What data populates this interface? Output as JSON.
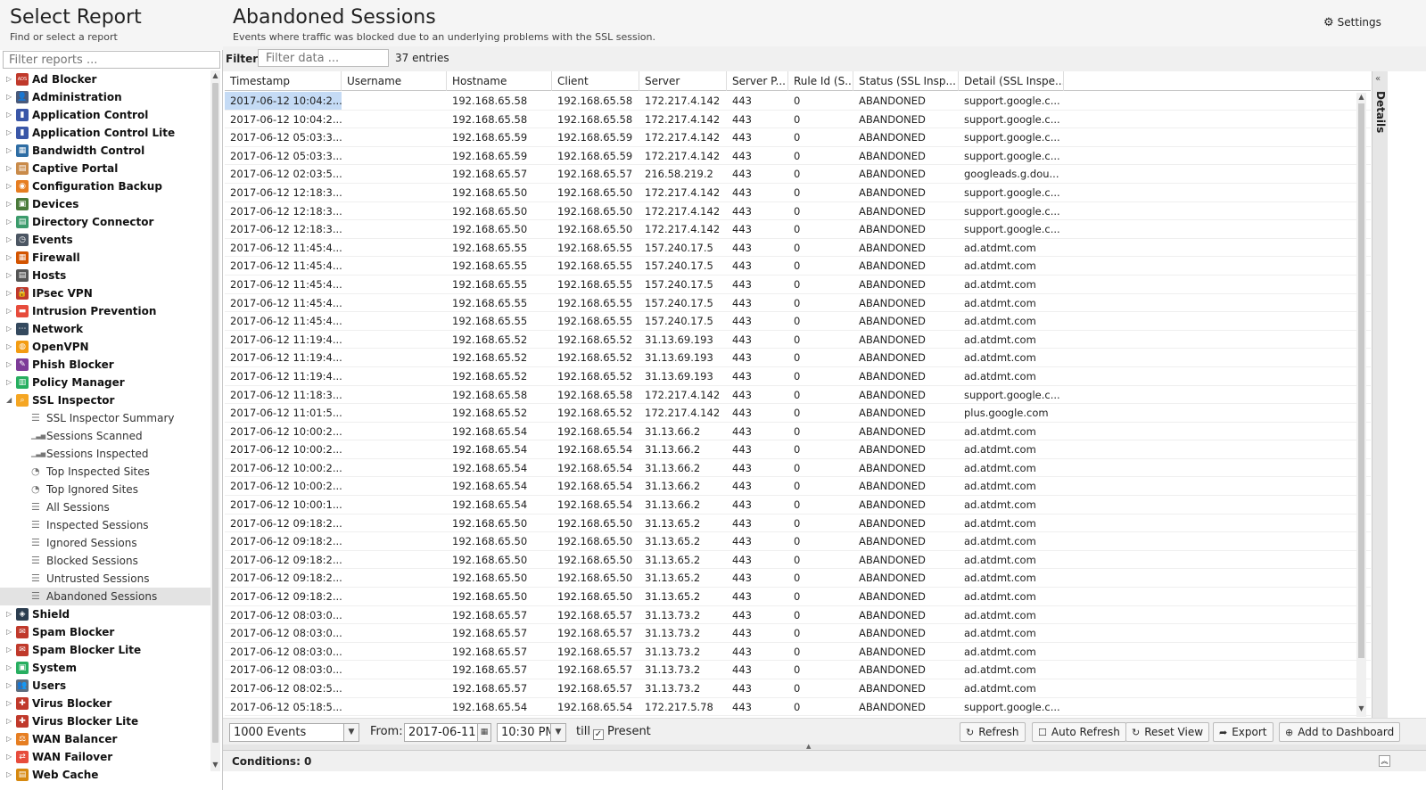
{
  "left": {
    "title": "Select Report",
    "subtitle": "Find or select a report",
    "filter_placeholder": "Filter reports ..."
  },
  "tree": [
    {
      "label": "Ad Blocker",
      "icon": "ad-blocker-icon",
      "color": "#c0392b",
      "glyph": "ADS"
    },
    {
      "label": "Administration",
      "icon": "administration-icon",
      "color": "#4a5a7a",
      "glyph": "👤"
    },
    {
      "label": "Application Control",
      "icon": "application-control-icon",
      "color": "#3a57a8",
      "glyph": "▮"
    },
    {
      "label": "Application Control Lite",
      "icon": "application-control-lite-icon",
      "color": "#3a57a8",
      "glyph": "▮"
    },
    {
      "label": "Bandwidth Control",
      "icon": "bandwidth-control-icon",
      "color": "#2e6da4",
      "glyph": "▦"
    },
    {
      "label": "Captive Portal",
      "icon": "captive-portal-icon",
      "color": "#c98b4a",
      "glyph": "▤"
    },
    {
      "label": "Configuration Backup",
      "icon": "configuration-backup-icon",
      "color": "#e67e22",
      "glyph": "◉"
    },
    {
      "label": "Devices",
      "icon": "devices-icon",
      "color": "#4a7a3a",
      "glyph": "▣"
    },
    {
      "label": "Directory Connector",
      "icon": "directory-connector-icon",
      "color": "#3c9b6c",
      "glyph": "▤"
    },
    {
      "label": "Events",
      "icon": "events-icon",
      "color": "#4c5663",
      "glyph": "◷"
    },
    {
      "label": "Firewall",
      "icon": "firewall-icon",
      "color": "#d35400",
      "glyph": "▦"
    },
    {
      "label": "Hosts",
      "icon": "hosts-icon",
      "color": "#555555",
      "glyph": "▤"
    },
    {
      "label": "IPsec VPN",
      "icon": "ipsec-vpn-icon",
      "color": "#c0392b",
      "glyph": "🔒"
    },
    {
      "label": "Intrusion Prevention",
      "icon": "intrusion-prevention-icon",
      "color": "#e74c3c",
      "glyph": "▬"
    },
    {
      "label": "Network",
      "icon": "network-icon",
      "color": "#34495e",
      "glyph": "⋯"
    },
    {
      "label": "OpenVPN",
      "icon": "openvpn-icon",
      "color": "#f39c12",
      "glyph": "◍"
    },
    {
      "label": "Phish Blocker",
      "icon": "phish-blocker-icon",
      "color": "#7d3c98",
      "glyph": "✎"
    },
    {
      "label": "Policy Manager",
      "icon": "policy-manager-icon",
      "color": "#27ae60",
      "glyph": "▥"
    },
    {
      "label": "SSL Inspector",
      "icon": "ssl-inspector-icon",
      "color": "#f5a623",
      "glyph": "⌕",
      "expanded": true,
      "children": [
        {
          "label": "SSL Inspector Summary",
          "icon": "list-icon",
          "glyph": "☰"
        },
        {
          "label": "Sessions Scanned",
          "icon": "bar-chart-icon",
          "glyph": "▁▃▅"
        },
        {
          "label": "Sessions Inspected",
          "icon": "bar-chart-icon",
          "glyph": "▁▃▅"
        },
        {
          "label": "Top Inspected Sites",
          "icon": "pie-chart-icon",
          "glyph": "◔"
        },
        {
          "label": "Top Ignored Sites",
          "icon": "pie-chart-icon",
          "glyph": "◔"
        },
        {
          "label": "All Sessions",
          "icon": "list-icon",
          "glyph": "☰"
        },
        {
          "label": "Inspected Sessions",
          "icon": "list-icon",
          "glyph": "☰"
        },
        {
          "label": "Ignored Sessions",
          "icon": "list-icon",
          "glyph": "☰"
        },
        {
          "label": "Blocked Sessions",
          "icon": "list-icon",
          "glyph": "☰"
        },
        {
          "label": "Untrusted Sessions",
          "icon": "list-icon",
          "glyph": "☰"
        },
        {
          "label": "Abandoned Sessions",
          "icon": "list-icon",
          "glyph": "☰",
          "selected": true
        }
      ]
    },
    {
      "label": "Shield",
      "icon": "shield-icon",
      "color": "#2c3e50",
      "glyph": "◈"
    },
    {
      "label": "Spam Blocker",
      "icon": "spam-blocker-icon",
      "color": "#c0392b",
      "glyph": "✉"
    },
    {
      "label": "Spam Blocker Lite",
      "icon": "spam-blocker-lite-icon",
      "color": "#c0392b",
      "glyph": "✉"
    },
    {
      "label": "System",
      "icon": "system-icon",
      "color": "#27ae60",
      "glyph": "▣"
    },
    {
      "label": "Users",
      "icon": "users-icon",
      "color": "#5d6d7e",
      "glyph": "👥"
    },
    {
      "label": "Virus Blocker",
      "icon": "virus-blocker-icon",
      "color": "#c0392b",
      "glyph": "✚"
    },
    {
      "label": "Virus Blocker Lite",
      "icon": "virus-blocker-lite-icon",
      "color": "#c0392b",
      "glyph": "✚"
    },
    {
      "label": "WAN Balancer",
      "icon": "wan-balancer-icon",
      "color": "#e67e22",
      "glyph": "⚖"
    },
    {
      "label": "WAN Failover",
      "icon": "wan-failover-icon",
      "color": "#e74c3c",
      "glyph": "⇄"
    },
    {
      "label": "Web Cache",
      "icon": "web-cache-icon",
      "color": "#d68910",
      "glyph": "▤"
    }
  ],
  "main": {
    "title": "Abandoned Sessions",
    "subtitle": "Events where traffic was blocked due to an underlying problems with the SSL session.",
    "settings_label": "Settings",
    "filter_label": "Filter:",
    "filter_placeholder": "Filter data ...",
    "entries_count": "37 entries"
  },
  "grid": {
    "columns": [
      "Timestamp",
      "Username",
      "Hostname",
      "Client",
      "Server",
      "Server P...",
      "Rule Id (S...",
      "Status (SSL Insp...",
      "Detail (SSL Inspe..."
    ],
    "rows": [
      [
        "2017-06-12 10:04:2...",
        "",
        "192.168.65.58",
        "192.168.65.58",
        "172.217.4.142",
        "443",
        "0",
        "ABANDONED",
        "support.google.c..."
      ],
      [
        "2017-06-12 10:04:2...",
        "",
        "192.168.65.58",
        "192.168.65.58",
        "172.217.4.142",
        "443",
        "0",
        "ABANDONED",
        "support.google.c..."
      ],
      [
        "2017-06-12 05:03:3...",
        "",
        "192.168.65.59",
        "192.168.65.59",
        "172.217.4.142",
        "443",
        "0",
        "ABANDONED",
        "support.google.c..."
      ],
      [
        "2017-06-12 05:03:3...",
        "",
        "192.168.65.59",
        "192.168.65.59",
        "172.217.4.142",
        "443",
        "0",
        "ABANDONED",
        "support.google.c..."
      ],
      [
        "2017-06-12 02:03:5...",
        "",
        "192.168.65.57",
        "192.168.65.57",
        "216.58.219.2",
        "443",
        "0",
        "ABANDONED",
        "googleads.g.dou..."
      ],
      [
        "2017-06-12 12:18:3...",
        "",
        "192.168.65.50",
        "192.168.65.50",
        "172.217.4.142",
        "443",
        "0",
        "ABANDONED",
        "support.google.c..."
      ],
      [
        "2017-06-12 12:18:3...",
        "",
        "192.168.65.50",
        "192.168.65.50",
        "172.217.4.142",
        "443",
        "0",
        "ABANDONED",
        "support.google.c..."
      ],
      [
        "2017-06-12 12:18:3...",
        "",
        "192.168.65.50",
        "192.168.65.50",
        "172.217.4.142",
        "443",
        "0",
        "ABANDONED",
        "support.google.c..."
      ],
      [
        "2017-06-12 11:45:4...",
        "",
        "192.168.65.55",
        "192.168.65.55",
        "157.240.17.5",
        "443",
        "0",
        "ABANDONED",
        "ad.atdmt.com"
      ],
      [
        "2017-06-12 11:45:4...",
        "",
        "192.168.65.55",
        "192.168.65.55",
        "157.240.17.5",
        "443",
        "0",
        "ABANDONED",
        "ad.atdmt.com"
      ],
      [
        "2017-06-12 11:45:4...",
        "",
        "192.168.65.55",
        "192.168.65.55",
        "157.240.17.5",
        "443",
        "0",
        "ABANDONED",
        "ad.atdmt.com"
      ],
      [
        "2017-06-12 11:45:4...",
        "",
        "192.168.65.55",
        "192.168.65.55",
        "157.240.17.5",
        "443",
        "0",
        "ABANDONED",
        "ad.atdmt.com"
      ],
      [
        "2017-06-12 11:45:4...",
        "",
        "192.168.65.55",
        "192.168.65.55",
        "157.240.17.5",
        "443",
        "0",
        "ABANDONED",
        "ad.atdmt.com"
      ],
      [
        "2017-06-12 11:19:4...",
        "",
        "192.168.65.52",
        "192.168.65.52",
        "31.13.69.193",
        "443",
        "0",
        "ABANDONED",
        "ad.atdmt.com"
      ],
      [
        "2017-06-12 11:19:4...",
        "",
        "192.168.65.52",
        "192.168.65.52",
        "31.13.69.193",
        "443",
        "0",
        "ABANDONED",
        "ad.atdmt.com"
      ],
      [
        "2017-06-12 11:19:4...",
        "",
        "192.168.65.52",
        "192.168.65.52",
        "31.13.69.193",
        "443",
        "0",
        "ABANDONED",
        "ad.atdmt.com"
      ],
      [
        "2017-06-12 11:18:3...",
        "",
        "192.168.65.58",
        "192.168.65.58",
        "172.217.4.142",
        "443",
        "0",
        "ABANDONED",
        "support.google.c..."
      ],
      [
        "2017-06-12 11:01:5...",
        "",
        "192.168.65.52",
        "192.168.65.52",
        "172.217.4.142",
        "443",
        "0",
        "ABANDONED",
        "plus.google.com"
      ],
      [
        "2017-06-12 10:00:2...",
        "",
        "192.168.65.54",
        "192.168.65.54",
        "31.13.66.2",
        "443",
        "0",
        "ABANDONED",
        "ad.atdmt.com"
      ],
      [
        "2017-06-12 10:00:2...",
        "",
        "192.168.65.54",
        "192.168.65.54",
        "31.13.66.2",
        "443",
        "0",
        "ABANDONED",
        "ad.atdmt.com"
      ],
      [
        "2017-06-12 10:00:2...",
        "",
        "192.168.65.54",
        "192.168.65.54",
        "31.13.66.2",
        "443",
        "0",
        "ABANDONED",
        "ad.atdmt.com"
      ],
      [
        "2017-06-12 10:00:2...",
        "",
        "192.168.65.54",
        "192.168.65.54",
        "31.13.66.2",
        "443",
        "0",
        "ABANDONED",
        "ad.atdmt.com"
      ],
      [
        "2017-06-12 10:00:1...",
        "",
        "192.168.65.54",
        "192.168.65.54",
        "31.13.66.2",
        "443",
        "0",
        "ABANDONED",
        "ad.atdmt.com"
      ],
      [
        "2017-06-12 09:18:2...",
        "",
        "192.168.65.50",
        "192.168.65.50",
        "31.13.65.2",
        "443",
        "0",
        "ABANDONED",
        "ad.atdmt.com"
      ],
      [
        "2017-06-12 09:18:2...",
        "",
        "192.168.65.50",
        "192.168.65.50",
        "31.13.65.2",
        "443",
        "0",
        "ABANDONED",
        "ad.atdmt.com"
      ],
      [
        "2017-06-12 09:18:2...",
        "",
        "192.168.65.50",
        "192.168.65.50",
        "31.13.65.2",
        "443",
        "0",
        "ABANDONED",
        "ad.atdmt.com"
      ],
      [
        "2017-06-12 09:18:2...",
        "",
        "192.168.65.50",
        "192.168.65.50",
        "31.13.65.2",
        "443",
        "0",
        "ABANDONED",
        "ad.atdmt.com"
      ],
      [
        "2017-06-12 09:18:2...",
        "",
        "192.168.65.50",
        "192.168.65.50",
        "31.13.65.2",
        "443",
        "0",
        "ABANDONED",
        "ad.atdmt.com"
      ],
      [
        "2017-06-12 08:03:0...",
        "",
        "192.168.65.57",
        "192.168.65.57",
        "31.13.73.2",
        "443",
        "0",
        "ABANDONED",
        "ad.atdmt.com"
      ],
      [
        "2017-06-12 08:03:0...",
        "",
        "192.168.65.57",
        "192.168.65.57",
        "31.13.73.2",
        "443",
        "0",
        "ABANDONED",
        "ad.atdmt.com"
      ],
      [
        "2017-06-12 08:03:0...",
        "",
        "192.168.65.57",
        "192.168.65.57",
        "31.13.73.2",
        "443",
        "0",
        "ABANDONED",
        "ad.atdmt.com"
      ],
      [
        "2017-06-12 08:03:0...",
        "",
        "192.168.65.57",
        "192.168.65.57",
        "31.13.73.2",
        "443",
        "0",
        "ABANDONED",
        "ad.atdmt.com"
      ],
      [
        "2017-06-12 08:02:5...",
        "",
        "192.168.65.57",
        "192.168.65.57",
        "31.13.73.2",
        "443",
        "0",
        "ABANDONED",
        "ad.atdmt.com"
      ],
      [
        "2017-06-12 05:18:5...",
        "",
        "192.168.65.54",
        "192.168.65.54",
        "172.217.5.78",
        "443",
        "0",
        "ABANDONED",
        "support.google.c..."
      ]
    ]
  },
  "details_label": "Details",
  "toolbar": {
    "limit_value": "1000 Events",
    "from_label": "From:",
    "from_date": "2017-06-11",
    "from_time": "10:30 PM",
    "till_label": "till",
    "present_label": "Present",
    "present_checked": "✓",
    "refresh_label": "Refresh",
    "auto_refresh_label": "Auto Refresh",
    "reset_view_label": "Reset View",
    "export_label": "Export",
    "add_dashboard_label": "Add to Dashboard"
  },
  "conditions_label": "Conditions: 0",
  "colors": {
    "accent": "#c5dbf5",
    "panel": "#f5f5f5"
  }
}
